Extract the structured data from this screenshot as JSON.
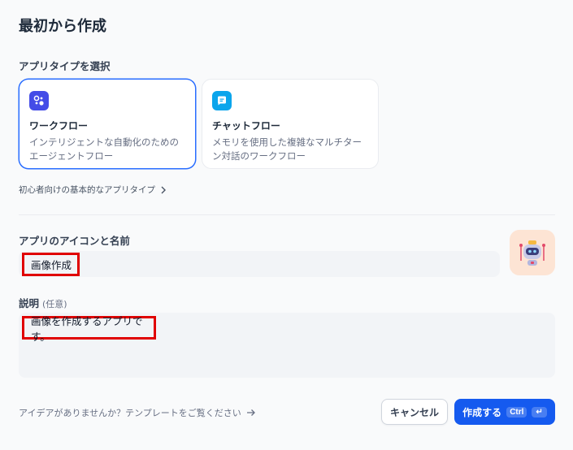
{
  "page": {
    "title": "最初から作成"
  },
  "app_type": {
    "label": "アプリタイプを選択",
    "cards": [
      {
        "title": "ワークフロー",
        "desc": "インテリジェントな自動化のためのエージェントフロー",
        "icon": "workflow-icon",
        "color": "#444ce7",
        "selected": true
      },
      {
        "title": "チャットフロー",
        "desc": "メモリを使用した複雑なマルチターン対話のワークフロー",
        "icon": "chatflow-icon",
        "color": "#0ba5ec",
        "selected": false
      }
    ],
    "basic_link": "初心者向けの基本的なアプリタイプ"
  },
  "name_section": {
    "label": "アプリのアイコンと名前",
    "value": "画像作成",
    "avatar_icon": "robot-icon",
    "avatar_bg": "#fde4d4"
  },
  "description": {
    "label": "説明",
    "optional": "(任意)",
    "value": "画像を作成するアプリです。"
  },
  "footer": {
    "template_link": "アイデアがありませんか？テンプレートをご覧ください",
    "cancel_label": "キャンセル",
    "create_label": "作成する",
    "shortcut_ctrl": "Ctrl",
    "shortcut_enter": "↵"
  },
  "colors": {
    "accent": "#155aef",
    "highlight": "#e00000"
  }
}
